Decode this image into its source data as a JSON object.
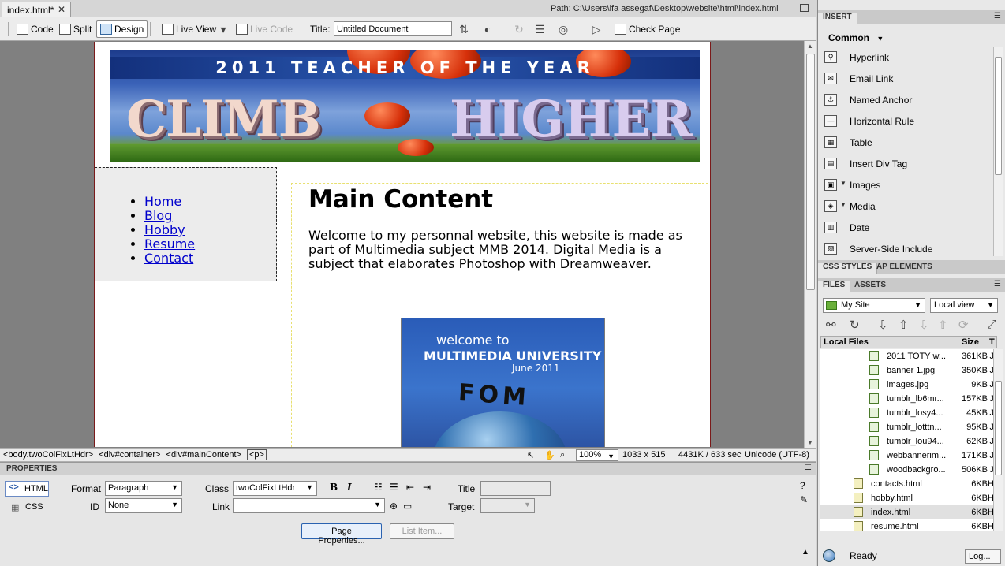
{
  "document": {
    "tab_title": "index.html*",
    "path_label": "Path:",
    "path": "C:\\Users\\ifa assegaf\\Desktop\\website\\html\\index.html"
  },
  "toolbar": {
    "code_label": "Code",
    "split_label": "Split",
    "design_label": "Design",
    "live_view_label": "Live View",
    "live_code_label": "Live Code",
    "title_label": "Title:",
    "title_value": "Untitled Document",
    "check_page_label": "Check Page"
  },
  "page": {
    "banner": {
      "title": "2011 TEACHER OF THE YEAR",
      "big_left": "CLIMB",
      "big_right": "HIGHER"
    },
    "nav": [
      "Home",
      "Blog",
      "Hobby",
      "Resume",
      "Contact"
    ],
    "main_heading": "Main Content",
    "main_text": "Welcome to my personnal website, this website is made as part of Multimedia subject MMB 2014. Digital Media is a subject that elaborates Photoshop with Dreamweaver.",
    "poster": {
      "line1": "welcome to",
      "line2": "MULTIMEDIA UNIVERSITY",
      "line3": "June 2011",
      "line4": "FOM"
    }
  },
  "tagbar": {
    "tags": [
      "<body.twoColFixLtHdr>",
      "<div#container>",
      "<div#mainContent>",
      "<p>"
    ],
    "zoom": "100%",
    "dimensions": "1033 x 515",
    "size_time": "4431K / 633 sec",
    "encoding": "Unicode (UTF-8)"
  },
  "properties": {
    "header": "PROPERTIES",
    "html_label": "HTML",
    "css_label": "CSS",
    "format_label": "Format",
    "format_value": "Paragraph",
    "id_label": "ID",
    "id_value": "None",
    "class_label": "Class",
    "class_value": "twoColFixLtHdr",
    "link_label": "Link",
    "link_value": "",
    "title_label": "Title",
    "target_label": "Target",
    "bold": "B",
    "italic": "I",
    "page_properties": "Page Properties...",
    "list_item": "List Item..."
  },
  "insert_panel": {
    "header": "INSERT",
    "category": "Common",
    "items": [
      {
        "label": "Hyperlink",
        "icon": "hyperlink-icon",
        "dropdown": false
      },
      {
        "label": "Email Link",
        "icon": "email-icon",
        "dropdown": false
      },
      {
        "label": "Named Anchor",
        "icon": "anchor-icon",
        "dropdown": false
      },
      {
        "label": "Horizontal Rule",
        "icon": "hr-icon",
        "dropdown": false
      },
      {
        "label": "Table",
        "icon": "table-icon",
        "dropdown": false
      },
      {
        "label": "Insert Div Tag",
        "icon": "div-icon",
        "dropdown": false
      },
      {
        "label": "Images",
        "icon": "image-icon",
        "dropdown": true
      },
      {
        "label": "Media",
        "icon": "media-icon",
        "dropdown": true
      },
      {
        "label": "Date",
        "icon": "date-icon",
        "dropdown": false
      },
      {
        "label": "Server-Side Include",
        "icon": "ssi-icon",
        "dropdown": false
      }
    ]
  },
  "css_panel": {
    "tab1": "CSS STYLES",
    "tab2": "AP ELEMENTS"
  },
  "files_panel": {
    "tab1": "FILES",
    "tab2": "ASSETS",
    "site": "My Site",
    "view": "Local view",
    "col_name": "Local Files",
    "col_size": "Size",
    "col_type": "T",
    "files": [
      {
        "name": "2011 TOTY w...",
        "size": "361KB",
        "type": "J",
        "kind": "image"
      },
      {
        "name": "banner 1.jpg",
        "size": "350KB",
        "type": "J",
        "kind": "image"
      },
      {
        "name": "images.jpg",
        "size": "9KB",
        "type": "J",
        "kind": "image"
      },
      {
        "name": "tumblr_lb6mr...",
        "size": "157KB",
        "type": "J",
        "kind": "image"
      },
      {
        "name": "tumblr_losy4...",
        "size": "45KB",
        "type": "J",
        "kind": "image"
      },
      {
        "name": "tumblr_lotttn...",
        "size": "95KB",
        "type": "J",
        "kind": "image"
      },
      {
        "name": "tumblr_lou94...",
        "size": "62KB",
        "type": "J",
        "kind": "image"
      },
      {
        "name": "webbannerim...",
        "size": "171KB",
        "type": "J",
        "kind": "image"
      },
      {
        "name": "woodbackgro...",
        "size": "506KB",
        "type": "J",
        "kind": "image"
      },
      {
        "name": "contacts.html",
        "size": "6KB",
        "type": "H",
        "kind": "html"
      },
      {
        "name": "hobby.html",
        "size": "6KB",
        "type": "H",
        "kind": "html"
      },
      {
        "name": "index.html",
        "size": "6KB",
        "type": "H",
        "kind": "html",
        "selected": true
      },
      {
        "name": "resume.html",
        "size": "6KB",
        "type": "H",
        "kind": "html"
      }
    ],
    "status": "Ready",
    "log_button": "Log..."
  }
}
